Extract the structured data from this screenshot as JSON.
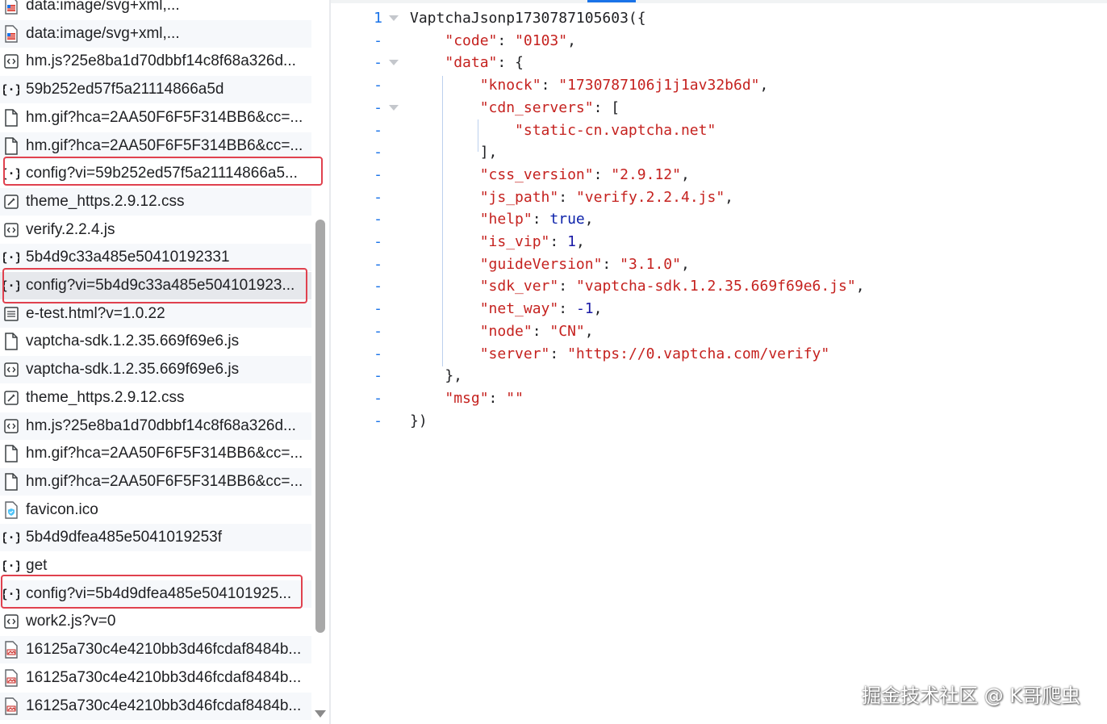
{
  "requests": [
    {
      "name": "data:image/svg+xml,...",
      "icon": "svg-image-icon"
    },
    {
      "name": "data:image/svg+xml,...",
      "icon": "svg-image-icon"
    },
    {
      "name": "hm.js?25e8ba1d70dbbf14c8f68a326d...",
      "icon": "script-icon"
    },
    {
      "name": "59b252ed57f5a21114866a5d",
      "icon": "json-icon"
    },
    {
      "name": "hm.gif?hca=2AA50F6F5F314BB6&cc=...",
      "icon": "document-icon"
    },
    {
      "name": "hm.gif?hca=2AA50F6F5F314BB6&cc=...",
      "icon": "document-icon"
    },
    {
      "name": "config?vi=59b252ed57f5a21114866a5...",
      "icon": "json-icon"
    },
    {
      "name": "theme_https.2.9.12.css",
      "icon": "stylesheet-icon"
    },
    {
      "name": "verify.2.2.4.js",
      "icon": "script-icon"
    },
    {
      "name": "5b4d9c33a485e50410192331",
      "icon": "json-icon"
    },
    {
      "name": "config?vi=5b4d9c33a485e504101923...",
      "icon": "json-icon"
    },
    {
      "name": "e-test.html?v=1.0.22",
      "icon": "html-document-icon"
    },
    {
      "name": "vaptcha-sdk.1.2.35.669f69e6.js",
      "icon": "document-icon"
    },
    {
      "name": "vaptcha-sdk.1.2.35.669f69e6.js",
      "icon": "script-icon"
    },
    {
      "name": "theme_https.2.9.12.css",
      "icon": "stylesheet-icon"
    },
    {
      "name": "hm.js?25e8ba1d70dbbf14c8f68a326d...",
      "icon": "script-icon"
    },
    {
      "name": "hm.gif?hca=2AA50F6F5F314BB6&cc=...",
      "icon": "document-icon"
    },
    {
      "name": "hm.gif?hca=2AA50F6F5F314BB6&cc=...",
      "icon": "document-icon"
    },
    {
      "name": "favicon.ico",
      "icon": "favicon-icon"
    },
    {
      "name": "5b4d9dfea485e5041019253f",
      "icon": "json-icon"
    },
    {
      "name": "get",
      "icon": "json-icon"
    },
    {
      "name": "config?vi=5b4d9dfea485e504101925...",
      "icon": "json-icon"
    },
    {
      "name": "work2.js?v=0",
      "icon": "script-icon"
    },
    {
      "name": "16125a730c4e4210bb3d46fcdaf8484b...",
      "icon": "image-icon"
    },
    {
      "name": "16125a730c4e4210bb3d46fcdaf8484b...",
      "icon": "image-icon"
    },
    {
      "name": "16125a730c4e4210bb3d46fcdaf8484b...",
      "icon": "image-icon"
    }
  ],
  "highlighted_request_indices": [
    6,
    10,
    21
  ],
  "selected_request_index": 10,
  "response": {
    "line_numbers": [
      "1",
      "-",
      "-",
      "-",
      "-",
      "-",
      "-",
      "-",
      "-",
      "-",
      "-",
      "-",
      "-",
      "-",
      "-",
      "-",
      "-",
      "-",
      "-"
    ],
    "lines": [
      [
        {
          "t": "p",
          "v": "VaptchaJsonp1730787105603({"
        }
      ],
      [
        {
          "t": "p",
          "v": "    "
        },
        {
          "t": "k",
          "v": "\"code\""
        },
        {
          "t": "p",
          "v": ": "
        },
        {
          "t": "s",
          "v": "\"0103\""
        },
        {
          "t": "p",
          "v": ","
        }
      ],
      [
        {
          "t": "p",
          "v": "    "
        },
        {
          "t": "k",
          "v": "\"data\""
        },
        {
          "t": "p",
          "v": ": {"
        }
      ],
      [
        {
          "t": "p",
          "v": "        "
        },
        {
          "t": "k",
          "v": "\"knock\""
        },
        {
          "t": "p",
          "v": ": "
        },
        {
          "t": "s",
          "v": "\"1730787106j1j1av32b6d\""
        },
        {
          "t": "p",
          "v": ","
        }
      ],
      [
        {
          "t": "p",
          "v": "        "
        },
        {
          "t": "k",
          "v": "\"cdn_servers\""
        },
        {
          "t": "p",
          "v": ": ["
        }
      ],
      [
        {
          "t": "p",
          "v": "            "
        },
        {
          "t": "s",
          "v": "\"static-cn.vaptcha.net\""
        }
      ],
      [
        {
          "t": "p",
          "v": "        ],"
        }
      ],
      [
        {
          "t": "p",
          "v": "        "
        },
        {
          "t": "k",
          "v": "\"css_version\""
        },
        {
          "t": "p",
          "v": ": "
        },
        {
          "t": "s",
          "v": "\"2.9.12\""
        },
        {
          "t": "p",
          "v": ","
        }
      ],
      [
        {
          "t": "p",
          "v": "        "
        },
        {
          "t": "k",
          "v": "\"js_path\""
        },
        {
          "t": "p",
          "v": ": "
        },
        {
          "t": "s",
          "v": "\"verify.2.2.4.js\""
        },
        {
          "t": "p",
          "v": ","
        }
      ],
      [
        {
          "t": "p",
          "v": "        "
        },
        {
          "t": "k",
          "v": "\"help\""
        },
        {
          "t": "p",
          "v": ": "
        },
        {
          "t": "b",
          "v": "true"
        },
        {
          "t": "p",
          "v": ","
        }
      ],
      [
        {
          "t": "p",
          "v": "        "
        },
        {
          "t": "k",
          "v": "\"is_vip\""
        },
        {
          "t": "p",
          "v": ": "
        },
        {
          "t": "n",
          "v": "1"
        },
        {
          "t": "p",
          "v": ","
        }
      ],
      [
        {
          "t": "p",
          "v": "        "
        },
        {
          "t": "k",
          "v": "\"guideVersion\""
        },
        {
          "t": "p",
          "v": ": "
        },
        {
          "t": "s",
          "v": "\"3.1.0\""
        },
        {
          "t": "p",
          "v": ","
        }
      ],
      [
        {
          "t": "p",
          "v": "        "
        },
        {
          "t": "k",
          "v": "\"sdk_ver\""
        },
        {
          "t": "p",
          "v": ": "
        },
        {
          "t": "s",
          "v": "\"vaptcha-sdk.1.2.35.669f69e6.js\""
        },
        {
          "t": "p",
          "v": ","
        }
      ],
      [
        {
          "t": "p",
          "v": "        "
        },
        {
          "t": "k",
          "v": "\"net_way\""
        },
        {
          "t": "p",
          "v": ": "
        },
        {
          "t": "n",
          "v": "-1"
        },
        {
          "t": "p",
          "v": ","
        }
      ],
      [
        {
          "t": "p",
          "v": "        "
        },
        {
          "t": "k",
          "v": "\"node\""
        },
        {
          "t": "p",
          "v": ": "
        },
        {
          "t": "s",
          "v": "\"CN\""
        },
        {
          "t": "p",
          "v": ","
        }
      ],
      [
        {
          "t": "p",
          "v": "        "
        },
        {
          "t": "k",
          "v": "\"server\""
        },
        {
          "t": "p",
          "v": ": "
        },
        {
          "t": "s",
          "v": "\"https://0.vaptcha.com/verify\""
        }
      ],
      [
        {
          "t": "p",
          "v": "    },"
        }
      ],
      [
        {
          "t": "p",
          "v": "    "
        },
        {
          "t": "k",
          "v": "\"msg\""
        },
        {
          "t": "p",
          "v": ": "
        },
        {
          "t": "s",
          "v": "\"\""
        }
      ],
      [
        {
          "t": "p",
          "v": "})"
        }
      ]
    ],
    "foldable_line_indices": [
      0,
      2,
      4
    ]
  },
  "watermark": "掘金技术社区 @ K哥爬虫",
  "colors": {
    "highlight_border": "#e0414e",
    "line_number": "#1a73e8",
    "json_key": "#c5221f",
    "json_string": "#c5221f",
    "json_number": "#1a1aa6"
  }
}
